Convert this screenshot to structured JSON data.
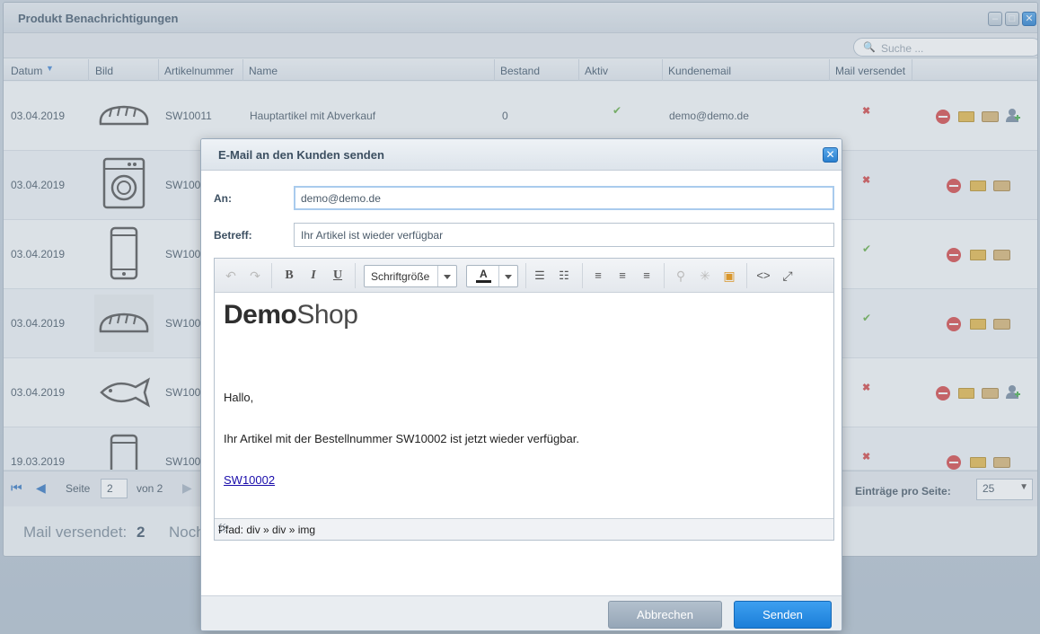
{
  "window": {
    "title": "Produkt Benachrichtigungen",
    "search_placeholder": "Suche ..."
  },
  "columns": [
    "Datum",
    "Bild",
    "Artikelnummer",
    "Name",
    "Bestand",
    "Aktiv",
    "Kundenemail",
    "Mail versendet"
  ],
  "rows": [
    {
      "date": "03.04.2019",
      "image": "bread-icon",
      "sku": "SW10011",
      "name": "Hauptartikel mit Abverkauf",
      "stock": "0",
      "active": true,
      "email": "demo@demo.de",
      "mail_sent": false,
      "has_user_action": true
    },
    {
      "date": "03.04.2019",
      "image": "washing-machine-icon",
      "sku": "SW100",
      "name": "",
      "stock": "",
      "active": null,
      "email": "",
      "mail_sent": false,
      "has_user_action": false
    },
    {
      "date": "03.04.2019",
      "image": "smartphone-icon",
      "sku": "SW100",
      "name": "",
      "stock": "",
      "active": null,
      "email": "",
      "mail_sent": true,
      "has_user_action": false
    },
    {
      "date": "03.04.2019",
      "image": "bread-icon",
      "sku": "SW100",
      "name": "",
      "stock": "",
      "active": null,
      "email": "",
      "mail_sent": true,
      "has_user_action": false
    },
    {
      "date": "03.04.2019",
      "image": "fish-icon",
      "sku": "SW100",
      "name": "",
      "stock": "",
      "active": null,
      "email": "",
      "mail_sent": false,
      "has_user_action": true
    },
    {
      "date": "19.03.2019",
      "image": "smartphone-icon",
      "sku": "SW100",
      "name": "",
      "stock": "",
      "active": null,
      "email": "",
      "mail_sent": false,
      "has_user_action": false
    }
  ],
  "pager": {
    "page_label": "Seite",
    "page_value": "2",
    "of_label": "von 2",
    "per_page_label": "Einträge pro Seite:",
    "per_page_value": "25"
  },
  "summary": {
    "mail_sent_label": "Mail versendet:",
    "mail_sent_count": "2",
    "pending_label": "Noch"
  },
  "modal": {
    "title": "E-Mail an den Kunden senden",
    "to_label": "An:",
    "to_value": "demo@demo.de",
    "subject_label": "Betreff:",
    "subject_value": "Ihr Artikel ist wieder verfügbar",
    "toolbar": {
      "font_size_label": "Schriftgröße",
      "font_color_label": "A"
    },
    "body": {
      "logo_bold": "Demo",
      "logo_light": "Shop",
      "greeting": "Hallo,",
      "message": "Ihr Artikel mit der Bestellnummer SW10002 ist jetzt wieder verfügbar.",
      "link_text": "SW10002"
    },
    "path_text": "Pfad: div » div » img",
    "cancel_label": "Abbrechen",
    "send_label": "Senden"
  },
  "colors": {
    "accent_blue": "#2a80cf",
    "ok_green": "#6ab04c",
    "error_red": "#d34a4a"
  }
}
